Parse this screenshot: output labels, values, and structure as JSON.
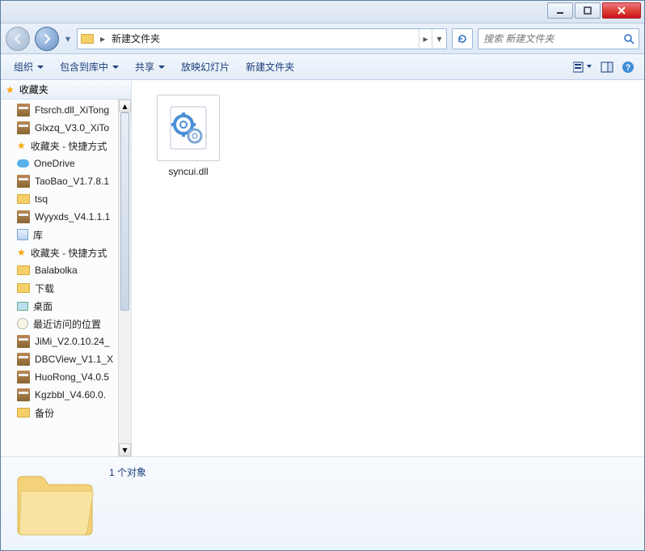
{
  "window": {
    "minimize_title": "最小化",
    "maximize_title": "最大化",
    "close_title": "关闭"
  },
  "nav": {
    "path_label": "新建文件夹",
    "path_chev": "▸",
    "search_placeholder": "搜索 新建文件夹"
  },
  "toolbar": {
    "organize": "组织",
    "include": "包含到库中",
    "share": "共享",
    "slideshow": "放映幻灯片",
    "newfolder": "新建文件夹"
  },
  "sidebar": {
    "header": "收藏夹",
    "items": [
      {
        "icon": "rar",
        "label": "Ftsrch.dll_XiTong"
      },
      {
        "icon": "rar",
        "label": "Glxzq_V3.0_XiTo"
      },
      {
        "icon": "star",
        "label": "收藏夹 - 快捷方式"
      },
      {
        "icon": "onedrive",
        "label": "OneDrive"
      },
      {
        "icon": "rar",
        "label": "TaoBao_V1.7.8.1"
      },
      {
        "icon": "folder",
        "label": "tsq"
      },
      {
        "icon": "rar",
        "label": "Wyyxds_V4.1.1.1"
      },
      {
        "icon": "lib",
        "label": "库"
      },
      {
        "icon": "star",
        "label": "收藏夹 - 快捷方式"
      },
      {
        "icon": "folder",
        "label": "Balabolka"
      },
      {
        "icon": "folder",
        "label": "下载"
      },
      {
        "icon": "desk",
        "label": "桌面"
      },
      {
        "icon": "recent",
        "label": "最近访问的位置"
      },
      {
        "icon": "rar",
        "label": "JiMi_V2.0.10.24_"
      },
      {
        "icon": "rar",
        "label": "DBCView_V1.1_X"
      },
      {
        "icon": "rar",
        "label": "HuoRong_V4.0.5"
      },
      {
        "icon": "rar",
        "label": "Kgzbbl_V4.60.0."
      },
      {
        "icon": "folder",
        "label": "备份"
      }
    ]
  },
  "content": {
    "files": [
      {
        "name": "syncui.dll",
        "type": "dll"
      }
    ]
  },
  "details": {
    "summary": "1 个对象"
  }
}
